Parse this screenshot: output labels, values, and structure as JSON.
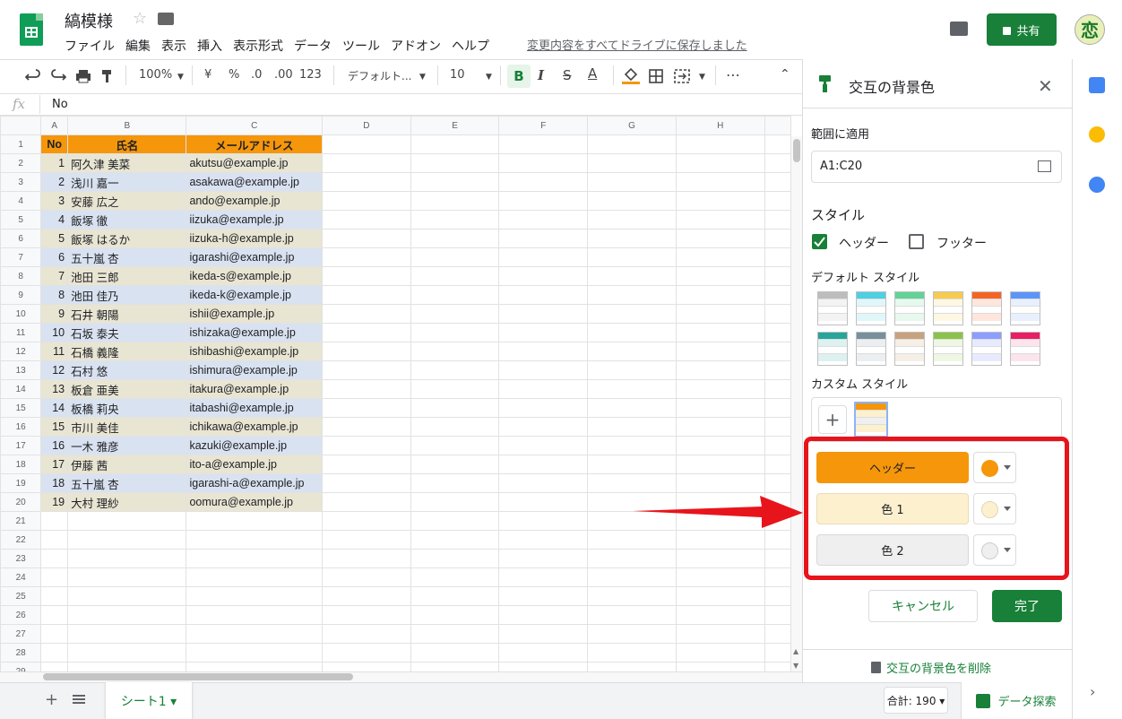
{
  "doc": {
    "title": "縞模様",
    "save_msg": "変更内容をすべてドライブに保存しました"
  },
  "menu": [
    "ファイル",
    "編集",
    "表示",
    "挿入",
    "表示形式",
    "データ",
    "ツール",
    "アドオン",
    "ヘルプ"
  ],
  "share_label": "共有",
  "avatar_char": "恋",
  "toolbar": {
    "zoom": "100%",
    "currency": "¥",
    "percent": "%",
    "dec_less": ".0",
    "dec_more": ".00",
    "format_more": "123",
    "font": "デフォルト...",
    "font_size": "10",
    "bold": "B",
    "italic": "I",
    "strike": "S",
    "text_color": "A",
    "more": "⋯"
  },
  "formula_bar": {
    "fx": "fx",
    "value": "No"
  },
  "columns": [
    "A",
    "B",
    "C",
    "D",
    "E",
    "F",
    "G",
    "H"
  ],
  "sheet": {
    "header": [
      "No",
      "氏名",
      "メールアドレス"
    ],
    "rows": [
      [
        "1",
        "阿久津 美菜",
        "akutsu@example.jp"
      ],
      [
        "2",
        "浅川 嘉一",
        "asakawa@example.jp"
      ],
      [
        "3",
        "安藤 広之",
        "ando@example.jp"
      ],
      [
        "4",
        "飯塚 徹",
        "iizuka@example.jp"
      ],
      [
        "5",
        "飯塚 はるか",
        "iizuka-h@example.jp"
      ],
      [
        "6",
        "五十嵐 杏",
        "igarashi@example.jp"
      ],
      [
        "7",
        "池田 三郎",
        "ikeda-s@example.jp"
      ],
      [
        "8",
        "池田 佳乃",
        "ikeda-k@example.jp"
      ],
      [
        "9",
        "石井 朝陽",
        "ishii@example.jp"
      ],
      [
        "10",
        "石坂 泰夫",
        "ishizaka@example.jp"
      ],
      [
        "11",
        "石橋 義隆",
        "ishibashi@example.jp"
      ],
      [
        "12",
        "石村 悠",
        "ishimura@example.jp"
      ],
      [
        "13",
        "板倉 亜美",
        "itakura@example.jp"
      ],
      [
        "14",
        "板橋 莉央",
        "itabashi@example.jp"
      ],
      [
        "15",
        "市川 美佳",
        "ichikawa@example.jp"
      ],
      [
        "16",
        "一木 雅彦",
        "kazuki@example.jp"
      ],
      [
        "17",
        "伊藤 茜",
        "ito-a@example.jp"
      ],
      [
        "18",
        "五十嵐 杏",
        "igarashi-a@example.jp"
      ],
      [
        "19",
        "大村 理紗",
        "oomura@example.jp"
      ]
    ],
    "row_numbers": [
      "1",
      "2",
      "3",
      "4",
      "5",
      "6",
      "7",
      "8",
      "9",
      "10",
      "11",
      "12",
      "13",
      "14",
      "15",
      "16",
      "17",
      "18",
      "19",
      "20",
      "21",
      "22",
      "23",
      "24",
      "25",
      "26",
      "27",
      "28",
      "29"
    ]
  },
  "bottom": {
    "add": "+",
    "sheet_tab": "シート1 ▾",
    "sum": "合計: 190 ▾",
    "explore": "データ探索"
  },
  "panel": {
    "title": "交互の背景色",
    "close": "✕",
    "range_label": "範囲に適用",
    "range_value": "A1:C20",
    "style_label": "スタイル",
    "header_check": "ヘッダー",
    "footer_check": "フッター",
    "default_styles_label": "デフォルト スタイル",
    "custom_styles_label": "カスタム スタイル",
    "plus": "+",
    "header_btn": "ヘッダー",
    "color1_btn": "色 1",
    "color2_btn": "色 2",
    "cancel": "キャンセル",
    "done": "完了",
    "remove": "交互の背景色を削除"
  },
  "colors": {
    "header": "#f5960b",
    "color1": "#fdf0cf",
    "color2": "#efefef",
    "accent": "#188038",
    "highlight": "#e8141c"
  },
  "default_swatches": [
    [
      "#bdbdbd",
      "#f3f3f3",
      "#ffffff"
    ],
    [
      "#4dd0e1",
      "#e0f7fa",
      "#ffffff"
    ],
    [
      "#63d297",
      "#e7f9ef",
      "#ffffff"
    ],
    [
      "#f7cb4d",
      "#fef8e3",
      "#ffffff"
    ],
    [
      "#f46524",
      "#ffe6dd",
      "#ffffff"
    ],
    [
      "#5b95f9",
      "#e8f0fe",
      "#ffffff"
    ],
    [
      "#26a69a",
      "#ddf2f0",
      "#ffffff"
    ],
    [
      "#78909c",
      "#ebeff1",
      "#ffffff"
    ],
    [
      "#c8a17d",
      "#f5efe8",
      "#ffffff"
    ],
    [
      "#8bc34a",
      "#eef7e3",
      "#ffffff"
    ],
    [
      "#8c9eff",
      "#e8eaff",
      "#ffffff"
    ],
    [
      "#e91e63",
      "#fce4ec",
      "#ffffff"
    ]
  ]
}
